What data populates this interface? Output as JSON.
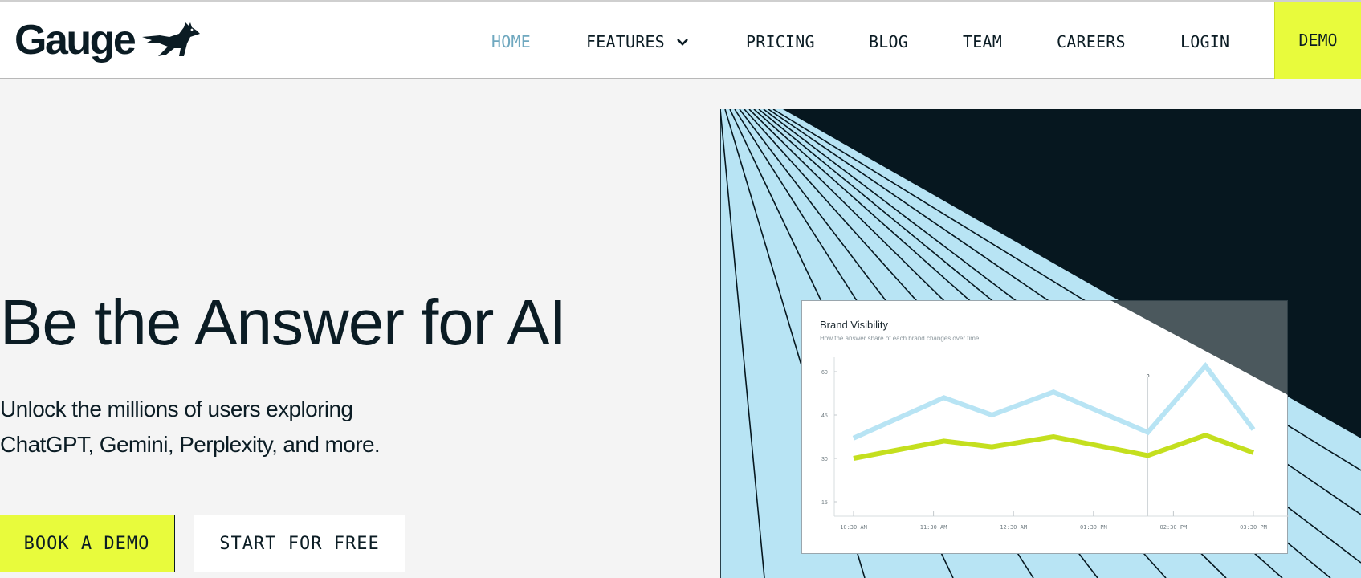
{
  "brand": {
    "name": "Gauge",
    "logo_icon": "dog-icon",
    "colors": {
      "accent": "#e8fb3c",
      "dark": "#06171f",
      "light_blue": "#b8e4f4",
      "active_nav": "#6fa8bf"
    }
  },
  "nav": {
    "items": [
      {
        "label": "HOME",
        "active": true
      },
      {
        "label": "FEATURES",
        "has_dropdown": true
      },
      {
        "label": "PRICING"
      },
      {
        "label": "BLOG"
      },
      {
        "label": "TEAM"
      },
      {
        "label": "CAREERS"
      },
      {
        "label": "LOGIN"
      }
    ],
    "demo_label": "DEMO",
    "dropdown_icon": "chevron-down-icon"
  },
  "hero": {
    "title": "Be the Answer for AI",
    "subtitle": "Unlock the millions of users exploring ChatGPT, Gemini, Perplexity, and more.",
    "primary_cta": "BOOK A DEMO",
    "secondary_cta": "START FOR FREE"
  },
  "chart_data": {
    "type": "line",
    "title": "Brand Visibility",
    "subtitle": "How the answer share of each brand changes over time.",
    "xlabel": "",
    "ylabel": "",
    "x": [
      "10:30 AM",
      "11:30 AM",
      "12:30 AM",
      "01:30 PM",
      "02:30 PM",
      "03:30 PM"
    ],
    "y_ticks": [
      15,
      30,
      45,
      60
    ],
    "ylim": [
      10,
      65
    ],
    "grid": false,
    "series": [
      {
        "color": "#b8e4f4",
        "points": [
          [
            0,
            37
          ],
          [
            1.13,
            51
          ],
          [
            1.73,
            45
          ],
          [
            2.5,
            53
          ],
          [
            3.68,
            39
          ],
          [
            4.4,
            62
          ],
          [
            5,
            40
          ]
        ]
      },
      {
        "color": "#c4df1e",
        "points": [
          [
            0,
            30
          ],
          [
            1.13,
            36
          ],
          [
            1.73,
            34
          ],
          [
            2.5,
            37.5
          ],
          [
            3.68,
            31
          ],
          [
            4.4,
            38
          ],
          [
            5,
            32
          ]
        ]
      }
    ],
    "marker": {
      "x": 3.68,
      "label": "o"
    }
  }
}
